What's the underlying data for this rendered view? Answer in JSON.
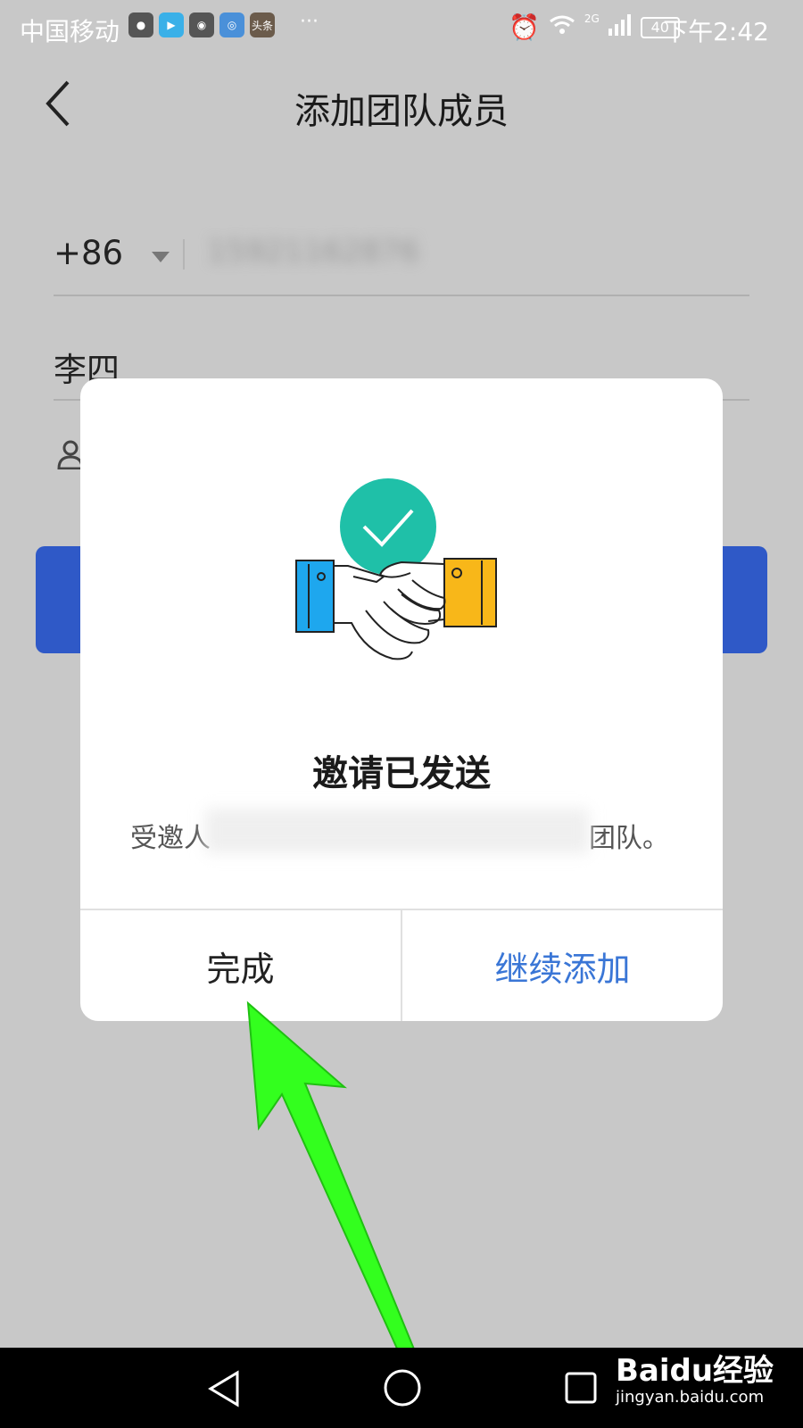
{
  "status_bar": {
    "carrier": "中国移动",
    "dots": "···",
    "battery": "40",
    "network": "2G",
    "time": "下午2:42",
    "app_icons": [
      "music-icon",
      "video-play-icon",
      "camera-icon",
      "browser-icon",
      "toutiao-icon"
    ],
    "toutiao_label": "头条"
  },
  "header": {
    "title": "添加团队成员"
  },
  "form": {
    "country_code": "+86",
    "phone_value": "15921162876",
    "name_value": "李四"
  },
  "dialog": {
    "title": "邀请已发送",
    "message_start": "受邀人",
    "message_end": "团队。",
    "done_label": "完成",
    "continue_label": "继续添加"
  },
  "colors": {
    "accent_blue": "#2f59c7",
    "link_blue": "#3a76d6",
    "check_teal": "#1fc0a8",
    "cuff_blue": "#1ea7ee",
    "cuff_yellow": "#f8b719",
    "arrow_green": "#33ff1e"
  },
  "watermark": {
    "main": "Baidu经验",
    "sub": "jingyan.baidu.com"
  }
}
